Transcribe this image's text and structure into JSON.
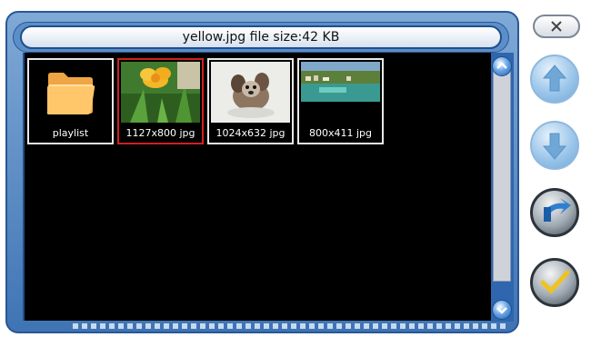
{
  "title": "yellow.jpg file size:42 KB",
  "items": [
    {
      "caption": "playlist",
      "kind": "folder",
      "selected": false
    },
    {
      "caption": "1127x800 jpg",
      "kind": "image",
      "selected": true
    },
    {
      "caption": "1024x632 jpg",
      "kind": "image",
      "selected": false
    },
    {
      "caption": "800x411 jpg",
      "kind": "image",
      "selected": false
    }
  ],
  "buttons": {
    "up": "up-arrow-icon",
    "down": "down-arrow-icon",
    "back": "back-arrow-icon",
    "ok": "checkmark-icon",
    "close": "close-icon"
  },
  "colors": {
    "frame": "#3f74b4",
    "selection": "#d22020",
    "background": "#000000"
  }
}
